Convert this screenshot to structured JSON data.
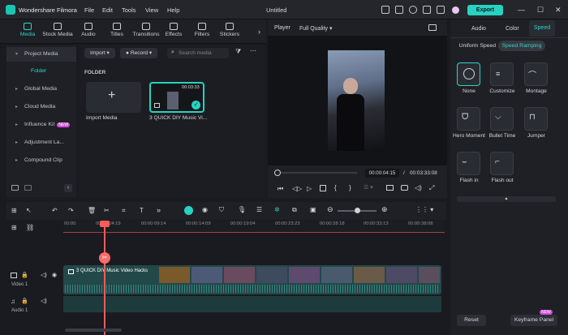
{
  "app": {
    "name": "Wondershare Filmora",
    "document_title": "Untitled",
    "export_label": "Export"
  },
  "menu": [
    "File",
    "Edit",
    "Tools",
    "View",
    "Help"
  ],
  "top_tabs": [
    {
      "label": "Media",
      "icon": "media-icon",
      "active": true
    },
    {
      "label": "Stock Media",
      "icon": "stock-media-icon",
      "active": false
    },
    {
      "label": "Audio",
      "icon": "audio-icon",
      "active": false
    },
    {
      "label": "Titles",
      "icon": "titles-icon",
      "active": false
    },
    {
      "label": "Transitions",
      "icon": "transitions-icon",
      "active": false
    },
    {
      "label": "Effects",
      "icon": "effects-icon",
      "active": false
    },
    {
      "label": "Filters",
      "icon": "filters-icon",
      "active": false
    },
    {
      "label": "Stickers",
      "icon": "stickers-icon",
      "active": false
    }
  ],
  "left_nav": {
    "items": [
      {
        "label": "Project Media",
        "selected": true
      },
      {
        "label": "Folder",
        "selected": false,
        "child": true
      },
      {
        "label": "Global Media",
        "selected": false
      },
      {
        "label": "Cloud Media",
        "selected": false
      },
      {
        "label": "Influence Kit",
        "selected": false,
        "badge": "NEW"
      },
      {
        "label": "Adjustment La...",
        "selected": false
      },
      {
        "label": "Compound Clip",
        "selected": false
      }
    ]
  },
  "media_toolbar": {
    "import_label": "Import",
    "record_label": "Record",
    "search_placeholder": "Search media"
  },
  "folder": {
    "heading": "FOLDER",
    "import_tile_label": "Import Media",
    "clip": {
      "label": "3 QUICK DIY Music Vi...",
      "duration": "00:03:33"
    }
  },
  "player": {
    "label": "Player",
    "quality": "Full Quality",
    "current_time": "00:00:04:15",
    "total_time": "00:03:33:08",
    "separator": "/",
    "progress": 0.02
  },
  "properties": {
    "tabs": [
      "Video",
      "Audio",
      "Color",
      "Speed"
    ],
    "active_tab": "Speed",
    "speed_subtabs": [
      "Uniform Speed",
      "Speed Ramping"
    ],
    "speed_options": [
      {
        "label": "None",
        "selected": true
      },
      {
        "label": "Customize",
        "selected": false
      },
      {
        "label": "Montage",
        "selected": false
      },
      {
        "label": "Hero Moment",
        "selected": false
      },
      {
        "label": "Bullet Time",
        "selected": false
      },
      {
        "label": "Jumper",
        "selected": false
      },
      {
        "label": "Flash in",
        "selected": false
      },
      {
        "label": "Flash out",
        "selected": false
      }
    ],
    "reset_label": "Reset",
    "keyframe_label": "Keyframe Panel",
    "keyframe_badge": "NEW"
  },
  "timeline": {
    "ruler": [
      "00:00",
      "00:00:04:19",
      "00:00:09:14",
      "00:00:14:09",
      "00:00:19:04",
      "00:00:23:23",
      "00:00:28:18",
      "00:00:33:13",
      "00:00:38:08"
    ],
    "video_track_label": "Video 1",
    "audio_track_label": "Audio 1",
    "clip_title": "3 QUICK DIY Music Video Hacks"
  }
}
